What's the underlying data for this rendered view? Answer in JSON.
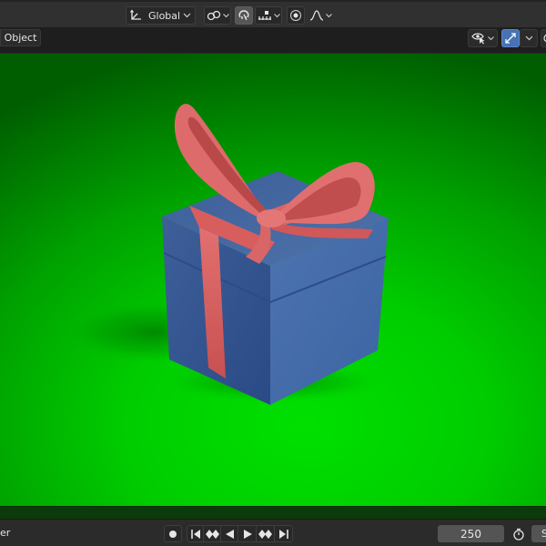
{
  "header": {
    "transform_orientation": "Global"
  },
  "viewport_header": {
    "mode_label": "Object"
  },
  "timeline": {
    "left_label_fragment": "er",
    "end_frame": "250",
    "right_label_fragment": "S"
  },
  "colors": {
    "background_green": "#00cc00",
    "box_blue": "#4a6fa8",
    "ribbon_pink": "#e06d6d",
    "active_accent": "#4772b3"
  },
  "icons": {
    "orientation": "transform-axes-icon",
    "pivot": "pivot-links-icon",
    "snap": "magnet-snap-icon",
    "snap_target": "snap-increment-icon",
    "proportional": "proportional-edit-icon",
    "falloff": "falloff-curve-icon",
    "visibility": "eye-cursor-icon",
    "gizmo": "gizmo-arrows-icon"
  }
}
